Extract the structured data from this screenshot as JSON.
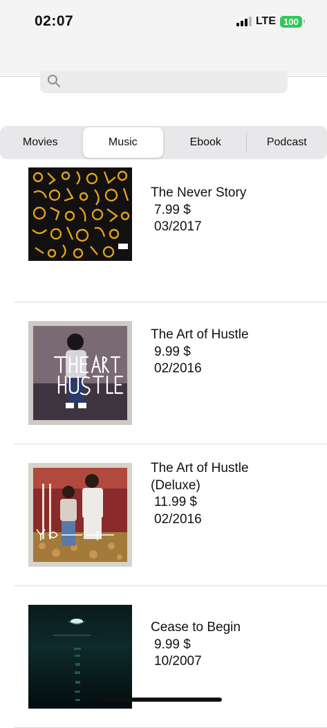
{
  "status_bar": {
    "time": "02:07",
    "network": "LTE",
    "battery": "100"
  },
  "search": {
    "placeholder": "",
    "icon": "search-icon"
  },
  "tabs": [
    {
      "label": "Movies",
      "active": false
    },
    {
      "label": "Music",
      "active": true
    },
    {
      "label": "Ebook",
      "active": false
    },
    {
      "label": "Podcast",
      "active": false
    }
  ],
  "albums": [
    {
      "title": "The Never Story",
      "price": "7.99 $",
      "date": "03/2017"
    },
    {
      "title": "The Art of Hustle",
      "price": "9.99 $",
      "date": "02/2016"
    },
    {
      "title": "The Art of Hustle (Deluxe)",
      "price": "11.99 $",
      "date": "02/2016"
    },
    {
      "title": "Cease to Begin",
      "price": "9.99 $",
      "date": "10/2007"
    }
  ],
  "colors": {
    "accent_battery": "#33c759",
    "segment_bg": "#e8e8ea"
  }
}
